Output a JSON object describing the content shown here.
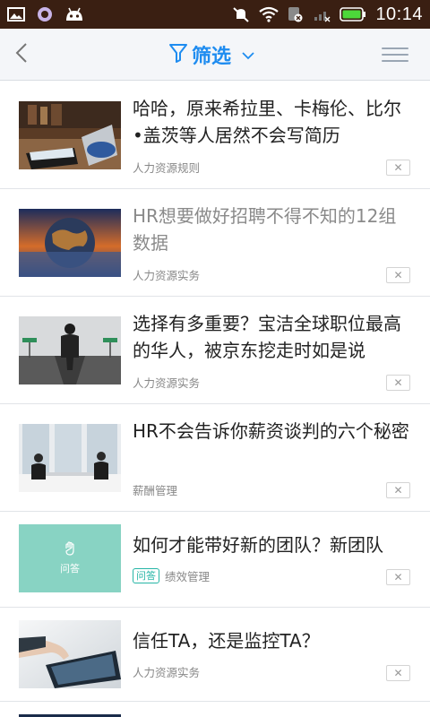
{
  "status_bar": {
    "time": "10:14",
    "icons": [
      "image-icon",
      "bubble-icon",
      "android-icon",
      "mute-icon",
      "wifi-icon",
      "sim-icon",
      "signal-icon",
      "battery-icon"
    ]
  },
  "header": {
    "filter_label": "筛选",
    "accent_color": "#1e8cf0"
  },
  "articles": [
    {
      "title": "哈哈，原来希拉里、卡梅伦、比尔•盖茨等人居然不会写简历",
      "category": "人力资源规则",
      "tag": "",
      "read": false,
      "thumb": "laptop-desk-photo"
    },
    {
      "title": "HR想要做好招聘不得不知的12组数据",
      "category": "人力资源实务",
      "tag": "",
      "read": true,
      "thumb": "globe-sunset-photo"
    },
    {
      "title": "选择有多重要？宝洁全球职位最高的华人，被京东挖走时如是说",
      "category": "人力资源实务",
      "tag": "",
      "read": false,
      "thumb": "crossroads-man-photo"
    },
    {
      "title": "HR不会告诉你薪资谈判的六个秘密",
      "category": "薪酬管理",
      "tag": "",
      "read": false,
      "thumb": "interview-photo"
    },
    {
      "title": "如何才能带好新的团队？新团队",
      "category": "绩效管理",
      "tag": "问答",
      "read": false,
      "thumb": "qa-placeholder",
      "thumb_label": "问答"
    },
    {
      "title": "信任TA，还是监控TA？",
      "category": "人力资源实务",
      "tag": "",
      "read": false,
      "thumb": "tablet-hand-photo"
    }
  ],
  "close_symbol": "✕"
}
